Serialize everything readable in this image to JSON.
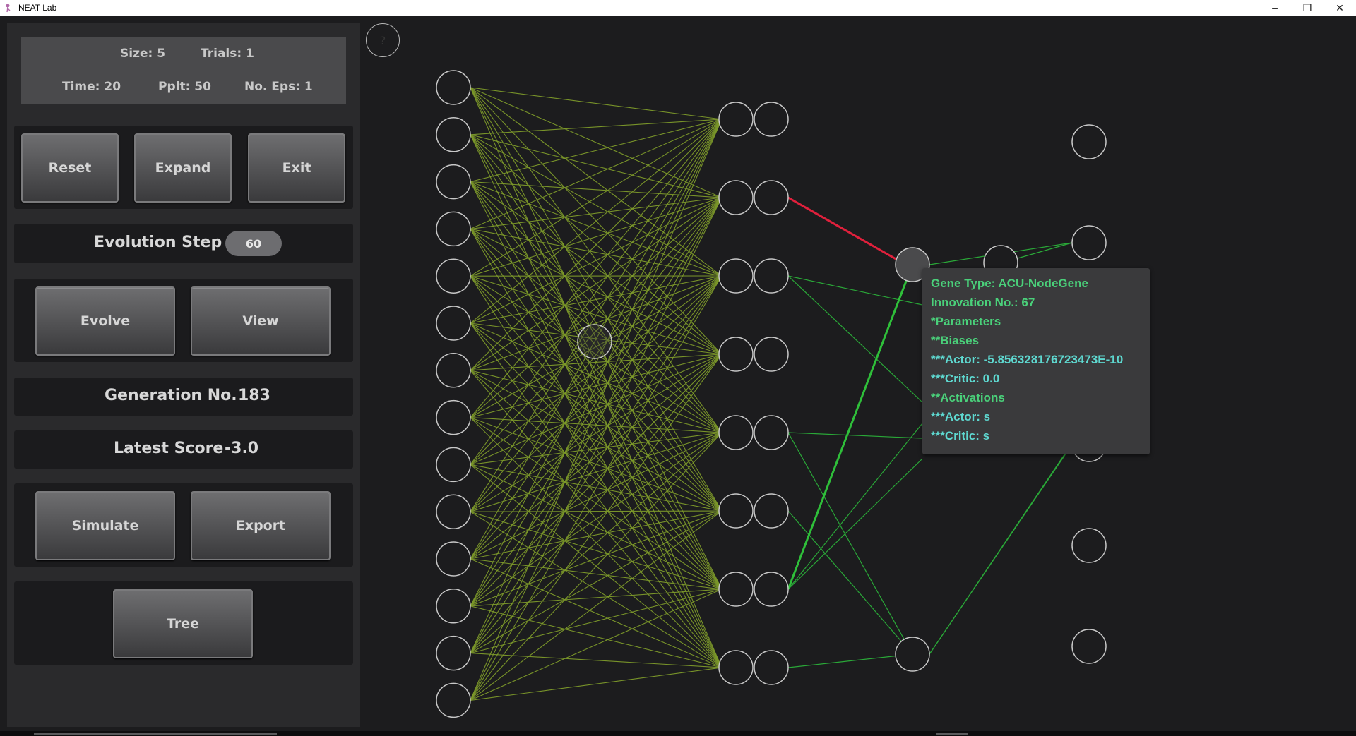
{
  "window": {
    "title": "NEAT Lab",
    "minimize_glyph": "–",
    "restore_glyph": "❐",
    "close_glyph": "✕"
  },
  "info": {
    "size": "Size: 5",
    "trials": "Trials: 1",
    "time": "Time: 20",
    "pplt": "Pplt: 50",
    "no_eps": "No. Eps: 1"
  },
  "controls": {
    "reset": "Reset",
    "expand": "Expand",
    "exit": "Exit"
  },
  "evolution": {
    "label": "Evolution Step",
    "value": "60"
  },
  "actions": {
    "evolve": "Evolve",
    "view": "View",
    "simulate": "Simulate",
    "export": "Export",
    "tree": "Tree"
  },
  "status": {
    "generation_label": "Generation No.",
    "generation_value": "183",
    "score_label": "Latest Score",
    "score_value": "-3.0"
  },
  "help": {
    "glyph": "?"
  },
  "tooltip": {
    "gene_type": "Gene Type: ACU-NodeGene",
    "innovation": "Innovation No.: 67",
    "parameters": "*Parameters",
    "biases": "**Biases",
    "actor_bias": "***Actor: -5.856328176723473E-10",
    "critic_bias": "***Critic: 0.0",
    "activations": "**Activations",
    "actor_act": "***Actor: s",
    "critic_act": "***Critic: s"
  },
  "colors": {
    "background": "#1c1c1e",
    "sidebar": "#2a2a2c",
    "dense_connection": "#7d9a2a",
    "green_connection": "#2aa838",
    "strong_green_connection": "#2fbf3a",
    "negative_connection": "#e0203c",
    "tooltip_green": "#4ad07a",
    "tooltip_cyan": "#5ed8d0",
    "node_stroke": "#c8c8c8"
  },
  "network": {
    "input_count": 14,
    "layer2_rows": 8,
    "output_count": 6
  }
}
